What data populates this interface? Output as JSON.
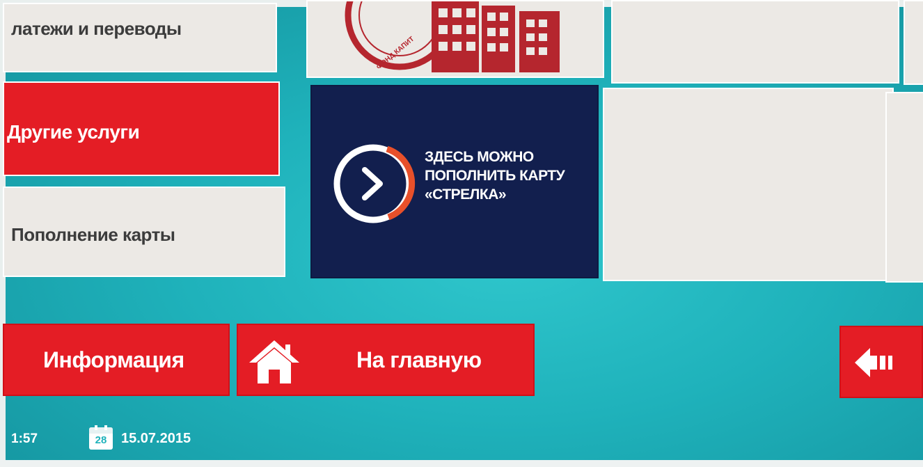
{
  "menu": {
    "payments_label": "латежи и переводы",
    "other_services_label": "Другие услуги",
    "card_topup_label": "Пополнение карты"
  },
  "promo": {
    "lines": [
      "ЗДЕСЬ МОЖНО",
      "ПОПОЛНИТЬ КАРТУ",
      "«СТРЕЛКА»"
    ]
  },
  "logo_tile": {
    "emblem_text": "ФОНД КАПИТ"
  },
  "footer": {
    "info_label": "Информация",
    "home_label": "На главную"
  },
  "status": {
    "time": "1:57",
    "calendar_day": "28",
    "date": "15.07.2015"
  },
  "colors": {
    "accent_red": "#e41d25",
    "navy": "#121f4e",
    "tile_light": "#ece9e5",
    "teal_background": "#1fb2bb",
    "logo_maroon": "#b5262e"
  },
  "icons": {
    "home": "home-icon",
    "back": "back-arrow-icon",
    "calendar": "calendar-icon",
    "strelka": "strelka-arrow-icon"
  }
}
